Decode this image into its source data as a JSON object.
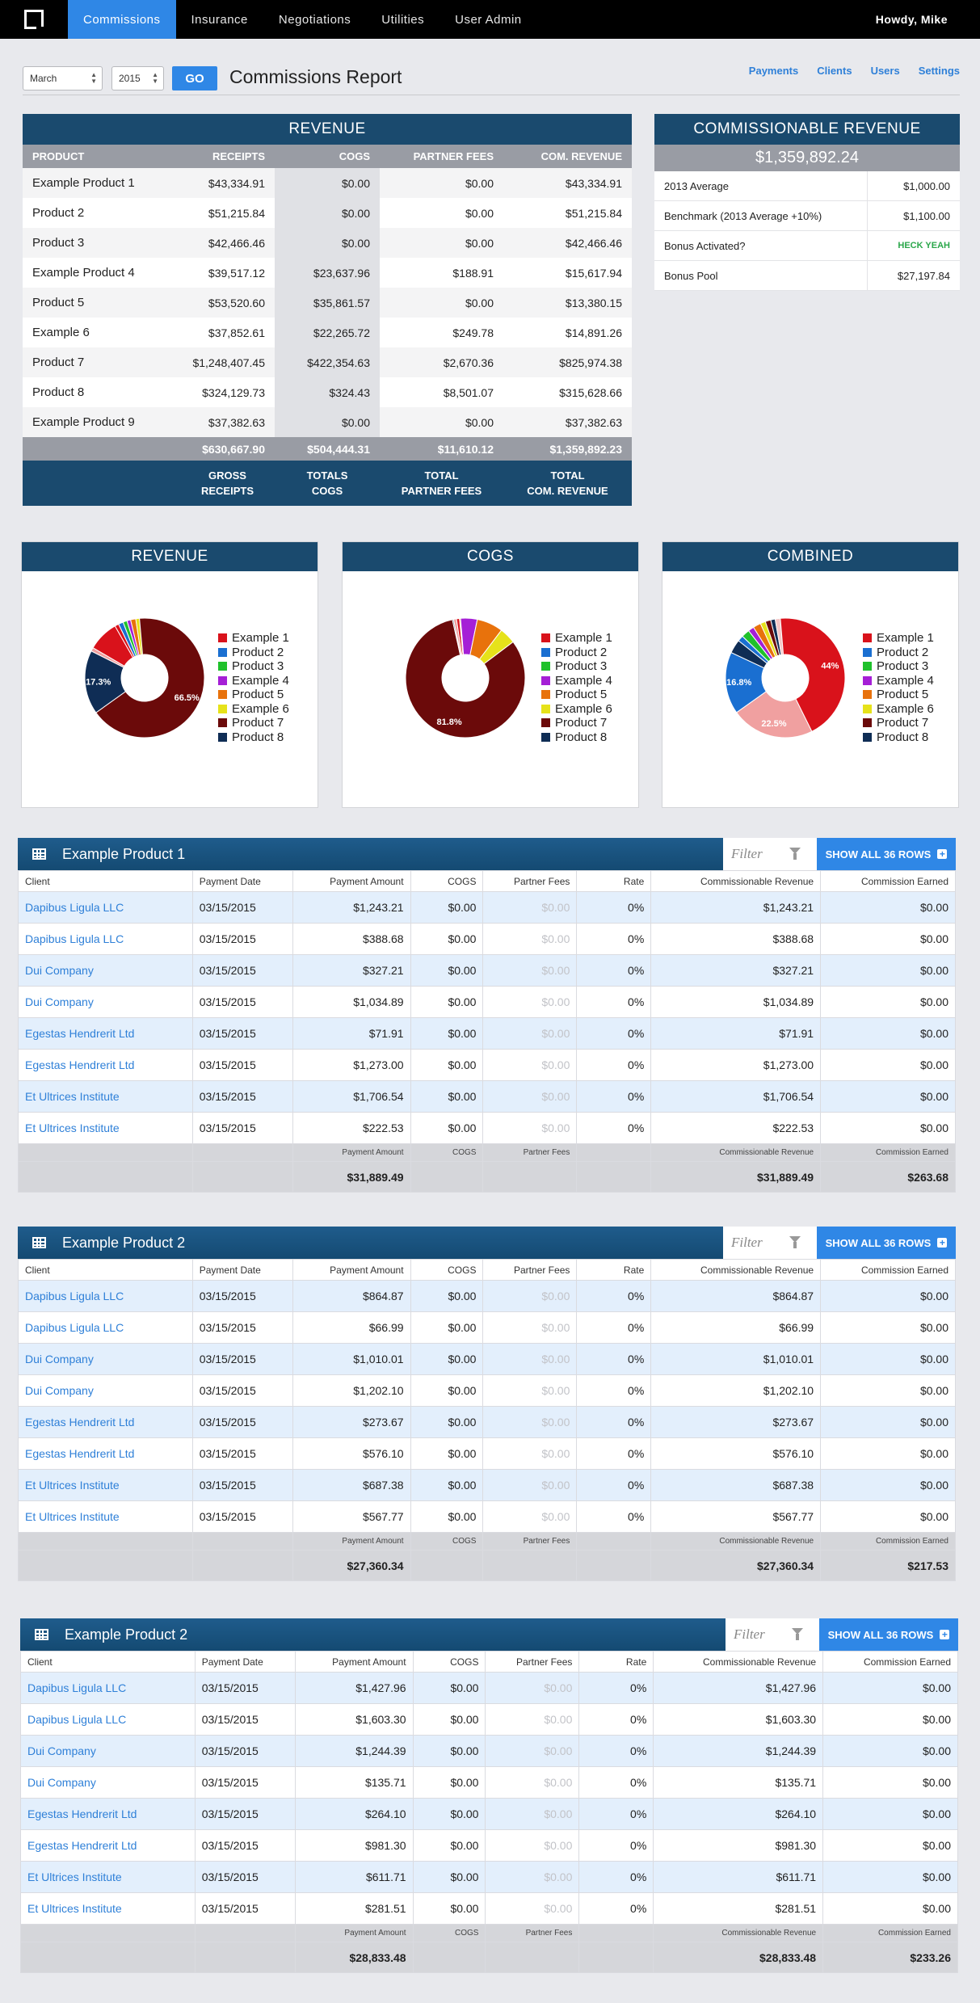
{
  "nav": {
    "tabs": [
      "Commissions",
      "Insurance",
      "Negotiations",
      "Utilities",
      "User Admin"
    ],
    "active": "Commissions",
    "greeting": "Howdy, Mike"
  },
  "report": {
    "month": "March",
    "year": "2015",
    "go_label": "GO",
    "title": "Commissions Report",
    "links": [
      "Payments",
      "Clients",
      "Users",
      "Settings"
    ]
  },
  "revenue": {
    "title": "REVENUE",
    "columns": [
      "PRODUCT",
      "RECEIPTS",
      "COGS",
      "PARTNER FEES",
      "COM. REVENUE"
    ],
    "rows": [
      [
        "Example Product 1",
        "$43,334.91",
        "$0.00",
        "$0.00",
        "$43,334.91"
      ],
      [
        "Product 2",
        "$51,215.84",
        "$0.00",
        "$0.00",
        "$51,215.84"
      ],
      [
        "Product 3",
        "$42,466.46",
        "$0.00",
        "$0.00",
        "$42,466.46"
      ],
      [
        "Example Product 4",
        "$39,517.12",
        "$23,637.96",
        "$188.91",
        "$15,617.94"
      ],
      [
        "Product 5",
        "$53,520.60",
        "$35,861.57",
        "$0.00",
        "$13,380.15"
      ],
      [
        "Example 6",
        "$37,852.61",
        "$22,265.72",
        "$249.78",
        "$14,891.26"
      ],
      [
        "Product 7",
        "$1,248,407.45",
        "$422,354.63",
        "$2,670.36",
        "$825,974.38"
      ],
      [
        "Product 8",
        "$324,129.73",
        "$324.43",
        "$8,501.07",
        "$315,628.66"
      ],
      [
        "Example Product 9",
        "$37,382.63",
        "$0.00",
        "$0.00",
        "$37,382.63"
      ]
    ],
    "totals": [
      "",
      "$630,667.90",
      "$504,444.31",
      "$11,610.12",
      "$1,359,892.23"
    ],
    "total_labels": [
      [
        "GROSS",
        "RECEIPTS"
      ],
      [
        "TOTALS",
        "COGS"
      ],
      [
        "TOTAL",
        "PARTNER FEES"
      ],
      [
        "TOTAL",
        "COM. REVENUE"
      ]
    ]
  },
  "commissionable": {
    "title": "COMMISSIONABLE REVENUE",
    "total": "$1,359,892.24",
    "rows": [
      {
        "label": "2013 Average",
        "value": "$1,000.00"
      },
      {
        "label": "Benchmark (2013 Average +10%)",
        "value": "$1,100.00"
      },
      {
        "label": "Bonus Activated?",
        "value": "HECK YEAH"
      },
      {
        "label": "Bonus Pool",
        "value": "$27,197.84"
      }
    ],
    "heck_color": "#2aa74a"
  },
  "pie_legend": [
    "Example 1",
    "Product 2",
    "Product 3",
    "Example 4",
    "Product 5",
    "Example 6",
    "Product 7",
    "Product 8"
  ],
  "pie_colors": [
    "#d9121b",
    "#1a6fd1",
    "#1fc12b",
    "#a51fd6",
    "#e8720c",
    "#e6e21a",
    "#6b0a0a",
    "#0f2d55"
  ],
  "pies": [
    {
      "title": "REVENUE",
      "slices": [
        1.1,
        1.3,
        1.1,
        1.0,
        1.4,
        1.0,
        66.5,
        17.3,
        1.0,
        8.3
      ],
      "colors": [
        "#d9121b",
        "#1a6fd1",
        "#1fc12b",
        "#a51fd6",
        "#e8720c",
        "#e6e21a",
        "#6b0a0a",
        "#0f2d55",
        "#f0a0a0",
        "#d9121b"
      ],
      "labels": [
        {
          "text": "66.5%",
          "slice": 6
        },
        {
          "text": "17.3%",
          "slice": 7
        }
      ]
    },
    {
      "title": "COGS",
      "slices": [
        0.8,
        0.8,
        0.3,
        4.5,
        7.1,
        4.4,
        81.8,
        0.3
      ],
      "colors": [
        "#f0a0a0",
        "#d9121b",
        "#e8720c",
        "#a51fd6",
        "#e8720c",
        "#e6e21a",
        "#6b0a0a",
        "#0f2d55"
      ],
      "labels": [
        {
          "text": "81.8%",
          "slice": 6
        }
      ]
    },
    {
      "title": "COMBINED",
      "slices": [
        1.6,
        2.2,
        1.6,
        2.1,
        1.4,
        1.5,
        1.2,
        1.4,
        44,
        22.5,
        16.8,
        3.7
      ],
      "colors": [
        "#1a6fd1",
        "#1fc12b",
        "#a51fd6",
        "#e8720c",
        "#e6e21a",
        "#6b0a0a",
        "#0f2d55",
        "#f5c6c6",
        "#d9121b",
        "#f0a0a0",
        "#1a6fd1",
        "#0f2d55"
      ],
      "labels": [
        {
          "text": "44%",
          "slice": 8
        },
        {
          "text": "22.5%",
          "slice": 9
        },
        {
          "text": "16.8%",
          "slice": 10
        }
      ]
    }
  ],
  "tables": [
    {
      "title": "Example Product 1",
      "filter_placeholder": "Filter",
      "show_all": "SHOW ALL 36 ROWS",
      "columns": [
        "Client",
        "Payment Date",
        "Payment Amount",
        "COGS",
        "Partner Fees",
        "Rate",
        "Commissionable Revenue",
        "Commission Earned"
      ],
      "rows": [
        [
          "Dapibus Ligula LLC",
          "03/15/2015",
          "$1,243.21",
          "$0.00",
          "$0.00",
          "0%",
          "$1,243.21",
          "$0.00"
        ],
        [
          "Dapibus Ligula LLC",
          "03/15/2015",
          "$388.68",
          "$0.00",
          "$0.00",
          "0%",
          "$388.68",
          "$0.00"
        ],
        [
          "Dui Company",
          "03/15/2015",
          "$327.21",
          "$0.00",
          "$0.00",
          "0%",
          "$327.21",
          "$0.00"
        ],
        [
          "Dui Company",
          "03/15/2015",
          "$1,034.89",
          "$0.00",
          "$0.00",
          "0%",
          "$1,034.89",
          "$0.00"
        ],
        [
          "Egestas Hendrerit Ltd",
          "03/15/2015",
          "$71.91",
          "$0.00",
          "$0.00",
          "0%",
          "$71.91",
          "$0.00"
        ],
        [
          "Egestas Hendrerit Ltd",
          "03/15/2015",
          "$1,273.00",
          "$0.00",
          "$0.00",
          "0%",
          "$1,273.00",
          "$0.00"
        ],
        [
          "Et Ultrices Institute",
          "03/15/2015",
          "$1,706.54",
          "$0.00",
          "$0.00",
          "0%",
          "$1,706.54",
          "$0.00"
        ],
        [
          "Et Ultrices Institute",
          "03/15/2015",
          "$222.53",
          "$0.00",
          "$0.00",
          "0%",
          "$222.53",
          "$0.00"
        ]
      ],
      "summary_labels": [
        "",
        "",
        "Payment Amount",
        "COGS",
        "Partner Fees",
        "",
        "Commissionable Revenue",
        "Commission Earned"
      ],
      "summary_values": [
        "",
        "",
        "$31,889.49",
        "",
        "",
        "",
        "$31,889.49",
        "$263.68"
      ]
    },
    {
      "title": "Example Product 2",
      "filter_placeholder": "Filter",
      "show_all": "SHOW ALL 36 ROWS",
      "columns": [
        "Client",
        "Payment Date",
        "Payment Amount",
        "COGS",
        "Partner Fees",
        "Rate",
        "Commissionable Revenue",
        "Commission Earned"
      ],
      "rows": [
        [
          "Dapibus Ligula LLC",
          "03/15/2015",
          "$864.87",
          "$0.00",
          "$0.00",
          "0%",
          "$864.87",
          "$0.00"
        ],
        [
          "Dapibus Ligula LLC",
          "03/15/2015",
          "$66.99",
          "$0.00",
          "$0.00",
          "0%",
          "$66.99",
          "$0.00"
        ],
        [
          "Dui Company",
          "03/15/2015",
          "$1,010.01",
          "$0.00",
          "$0.00",
          "0%",
          "$1,010.01",
          "$0.00"
        ],
        [
          "Dui Company",
          "03/15/2015",
          "$1,202.10",
          "$0.00",
          "$0.00",
          "0%",
          "$1,202.10",
          "$0.00"
        ],
        [
          "Egestas Hendrerit Ltd",
          "03/15/2015",
          "$273.67",
          "$0.00",
          "$0.00",
          "0%",
          "$273.67",
          "$0.00"
        ],
        [
          "Egestas Hendrerit Ltd",
          "03/15/2015",
          "$576.10",
          "$0.00",
          "$0.00",
          "0%",
          "$576.10",
          "$0.00"
        ],
        [
          "Et Ultrices Institute",
          "03/15/2015",
          "$687.38",
          "$0.00",
          "$0.00",
          "0%",
          "$687.38",
          "$0.00"
        ],
        [
          "Et Ultrices Institute",
          "03/15/2015",
          "$567.77",
          "$0.00",
          "$0.00",
          "0%",
          "$567.77",
          "$0.00"
        ]
      ],
      "summary_labels": [
        "",
        "",
        "Payment Amount",
        "COGS",
        "Partner Fees",
        "",
        "Commissionable Revenue",
        "Commission Earned"
      ],
      "summary_values": [
        "",
        "",
        "$27,360.34",
        "",
        "",
        "",
        "$27,360.34",
        "$217.53"
      ]
    },
    {
      "title": "Example Product 2",
      "filter_placeholder": "Filter",
      "show_all": "SHOW ALL 36 ROWS",
      "columns": [
        "Client",
        "Payment Date",
        "Payment Amount",
        "COGS",
        "Partner Fees",
        "Rate",
        "Commissionable Revenue",
        "Commission Earned"
      ],
      "rows": [
        [
          "Dapibus Ligula LLC",
          "03/15/2015",
          "$1,427.96",
          "$0.00",
          "$0.00",
          "0%",
          "$1,427.96",
          "$0.00"
        ],
        [
          "Dapibus Ligula LLC",
          "03/15/2015",
          "$1,603.30",
          "$0.00",
          "$0.00",
          "0%",
          "$1,603.30",
          "$0.00"
        ],
        [
          "Dui Company",
          "03/15/2015",
          "$1,244.39",
          "$0.00",
          "$0.00",
          "0%",
          "$1,244.39",
          "$0.00"
        ],
        [
          "Dui Company",
          "03/15/2015",
          "$135.71",
          "$0.00",
          "$0.00",
          "0%",
          "$135.71",
          "$0.00"
        ],
        [
          "Egestas Hendrerit Ltd",
          "03/15/2015",
          "$264.10",
          "$0.00",
          "$0.00",
          "0%",
          "$264.10",
          "$0.00"
        ],
        [
          "Egestas Hendrerit Ltd",
          "03/15/2015",
          "$981.30",
          "$0.00",
          "$0.00",
          "0%",
          "$981.30",
          "$0.00"
        ],
        [
          "Et Ultrices Institute",
          "03/15/2015",
          "$611.71",
          "$0.00",
          "$0.00",
          "0%",
          "$611.71",
          "$0.00"
        ],
        [
          "Et Ultrices Institute",
          "03/15/2015",
          "$281.51",
          "$0.00",
          "$0.00",
          "0%",
          "$281.51",
          "$0.00"
        ]
      ],
      "summary_labels": [
        "",
        "",
        "Payment Amount",
        "COGS",
        "Partner Fees",
        "",
        "Commissionable Revenue",
        "Commission Earned"
      ],
      "summary_values": [
        "",
        "",
        "$28,833.48",
        "",
        "",
        "",
        "$28,833.48",
        "$233.26"
      ]
    }
  ]
}
